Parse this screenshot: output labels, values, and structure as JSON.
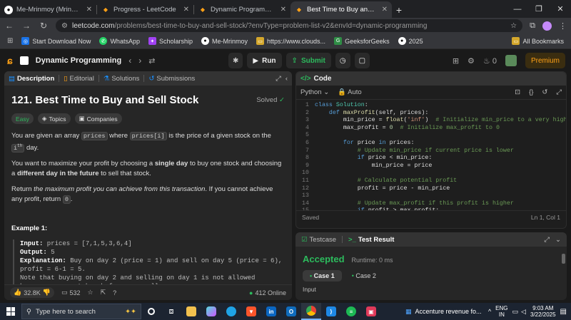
{
  "browser": {
    "tabs": [
      {
        "label": "Me-Mrinmoy (Mrinmoy Saman",
        "active": false
      },
      {
        "label": "Progress - LeetCode",
        "active": false
      },
      {
        "label": "Dynamic Programming - LeetC",
        "active": false
      },
      {
        "label": "Best Time to Buy and Sell Stock",
        "active": true
      }
    ],
    "new_tab": "+",
    "url_main": "leetcode.com",
    "url_rest": "/problems/best-time-to-buy-and-sell-stock/?envType=problem-list-v2&envId=dynamic-programming",
    "bookmarks": [
      {
        "label": "Start Download Now",
        "color": "#1a73e8"
      },
      {
        "label": "WhatsApp",
        "color": "#25d366"
      },
      {
        "label": "Scholarship",
        "color": "#a142f4"
      },
      {
        "label": "Me-Mrinmoy",
        "color": "#444444"
      },
      {
        "label": "https://www.clouds...",
        "color": "#888888"
      },
      {
        "label": "GeeksforGeeks",
        "color": "#2f8d46"
      },
      {
        "label": "2025",
        "color": "#444444"
      }
    ],
    "all_bookmarks": "All Bookmarks"
  },
  "lc_nav": {
    "list_title": "Dynamic Programming",
    "run": "Run",
    "submit": "Submit",
    "streak": "0",
    "premium": "Premium"
  },
  "left": {
    "tabs": [
      "Description",
      "Editorial",
      "Solutions",
      "Submissions"
    ],
    "title": "121. Best Time to Buy and Sell Stock",
    "solved": "Solved",
    "tags": [
      "Easy",
      "Topics",
      "Companies"
    ],
    "p1_a": "You are given an array ",
    "p1_code1": "prices",
    "p1_b": " where ",
    "p1_code2": "prices[i]",
    "p1_c": " is the price of a given stock on the ",
    "p1_code3": "i",
    "p1_sup": "th",
    "p1_d": " day.",
    "p2_a": "You want to maximize your profit by choosing a ",
    "p2_b1": "single day",
    "p2_b": " to buy one stock and choosing a ",
    "p2_b2": "different day in the future",
    "p2_c": " to sell that stock.",
    "p3_a": "Return ",
    "p3_i": "the maximum profit you can achieve from this transaction",
    "p3_b": ". If you cannot achieve any profit, return ",
    "p3_code": "0",
    "p3_c": ".",
    "example_title": "Example 1:",
    "ex_input_label": "Input:",
    "ex_input": " prices = [7,1,5,3,6,4]",
    "ex_output_label": "Output:",
    "ex_output": " 5",
    "ex_expl_label": "Explanation:",
    "ex_expl": " Buy on day 2 (price = 1) and sell on day 5 (price = 6), profit = 6-1 = 5.",
    "ex_note": "Note that buying on day 2 and selling on day 1 is not allowed because you must buy before you sell.",
    "likes": "32.8K",
    "comments": "532",
    "online": "412 Online"
  },
  "code": {
    "header": "Code",
    "language": "Python",
    "mode": "Auto",
    "lines": [
      "class Solution:",
      "    def maxProfit(self, prices):",
      "        min_price = float('inf')  # Initialize min_price to a very high value",
      "        max_profit = 0  # Initialize max_profit to 0",
      "",
      "        for price in prices:",
      "            # Update min_price if current price is lower",
      "            if price < min_price:",
      "                min_price = price",
      "",
      "            # Calculate potential profit",
      "            profit = price - min_price",
      "",
      "            # Update max_profit if this profit is higher",
      "            if profit > max_profit:"
    ],
    "saved": "Saved",
    "cursor": "Ln 1, Col 1"
  },
  "test": {
    "tab_testcase": "Testcase",
    "tab_result": "Test Result",
    "status": "Accepted",
    "runtime": "Runtime: 0 ms",
    "case1": "Case 1",
    "case2": "Case 2",
    "input_label": "Input"
  },
  "taskbar": {
    "search": "Type here to search",
    "news": "Accenture revenue fo...",
    "lang": "ENG",
    "region": "IN",
    "time": "9:03 AM",
    "date": "3/22/2025"
  }
}
